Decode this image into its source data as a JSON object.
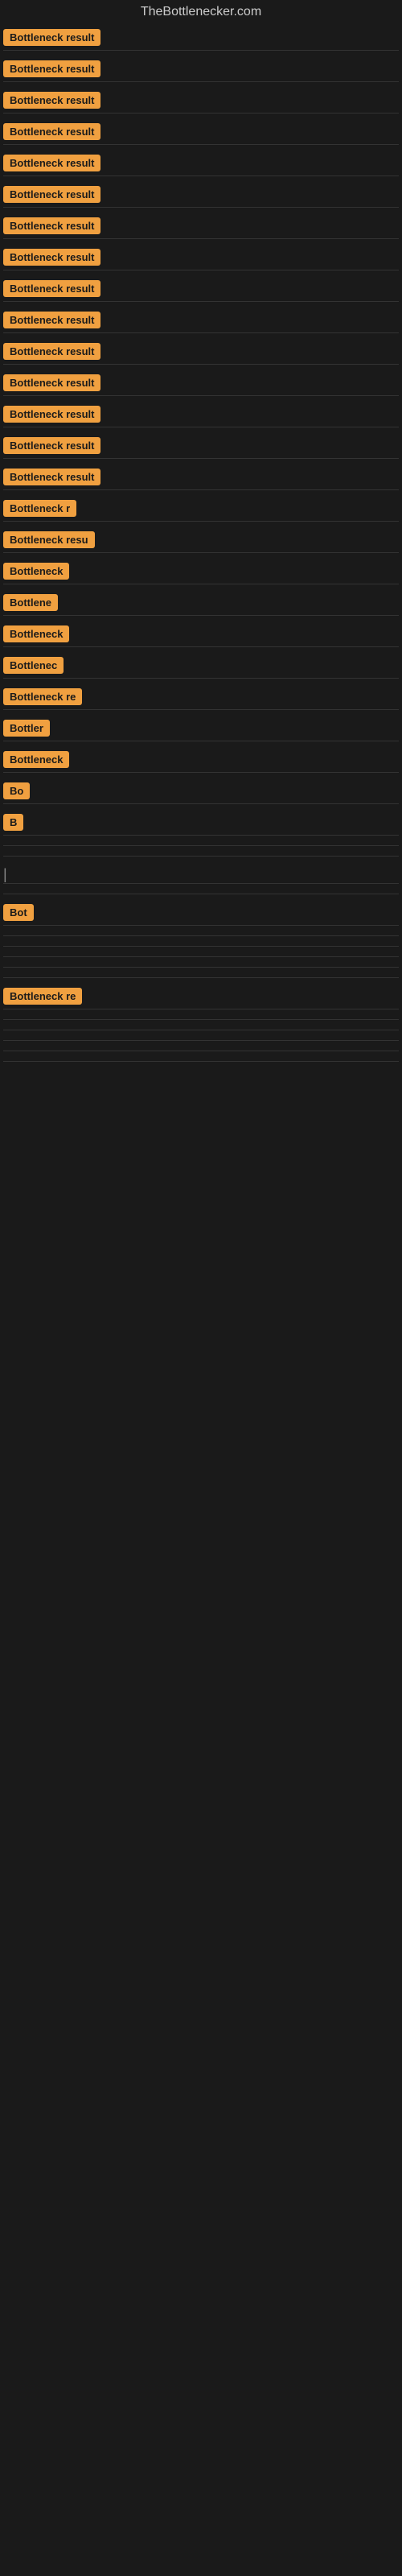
{
  "site": {
    "title": "TheBottlenecker.com"
  },
  "rows": [
    {
      "label": "Bottleneck result",
      "width": 130
    },
    {
      "label": "Bottleneck result",
      "width": 130
    },
    {
      "label": "Bottleneck result",
      "width": 130
    },
    {
      "label": "Bottleneck result",
      "width": 130
    },
    {
      "label": "Bottleneck result",
      "width": 130
    },
    {
      "label": "Bottleneck result",
      "width": 130
    },
    {
      "label": "Bottleneck result",
      "width": 130
    },
    {
      "label": "Bottleneck result",
      "width": 130
    },
    {
      "label": "Bottleneck result",
      "width": 130
    },
    {
      "label": "Bottleneck result",
      "width": 130
    },
    {
      "label": "Bottleneck result",
      "width": 130
    },
    {
      "label": "Bottleneck result",
      "width": 130
    },
    {
      "label": "Bottleneck result",
      "width": 130
    },
    {
      "label": "Bottleneck result",
      "width": 130
    },
    {
      "label": "Bottleneck result",
      "width": 130
    },
    {
      "label": "Bottleneck r",
      "width": 105
    },
    {
      "label": "Bottleneck resu",
      "width": 115
    },
    {
      "label": "Bottleneck",
      "width": 90
    },
    {
      "label": "Bottlene",
      "width": 78
    },
    {
      "label": "Bottleneck",
      "width": 90
    },
    {
      "label": "Bottlenec",
      "width": 82
    },
    {
      "label": "Bottleneck re",
      "width": 108
    },
    {
      "label": "Bottler",
      "width": 68
    },
    {
      "label": "Bottleneck",
      "width": 90
    },
    {
      "label": "Bo",
      "width": 32
    },
    {
      "label": "B",
      "width": 18
    },
    {
      "label": "",
      "width": 0
    },
    {
      "label": "",
      "width": 0
    },
    {
      "label": "|",
      "width": 10
    },
    {
      "label": "",
      "width": 0
    },
    {
      "label": "Bot",
      "width": 38
    },
    {
      "label": "",
      "width": 0
    },
    {
      "label": "",
      "width": 0
    },
    {
      "label": "",
      "width": 0
    },
    {
      "label": "",
      "width": 0
    },
    {
      "label": "",
      "width": 0
    },
    {
      "label": "Bottleneck re",
      "width": 108
    },
    {
      "label": "",
      "width": 0
    },
    {
      "label": "",
      "width": 0
    },
    {
      "label": "",
      "width": 0
    },
    {
      "label": "",
      "width": 0
    },
    {
      "label": "",
      "width": 0
    }
  ]
}
